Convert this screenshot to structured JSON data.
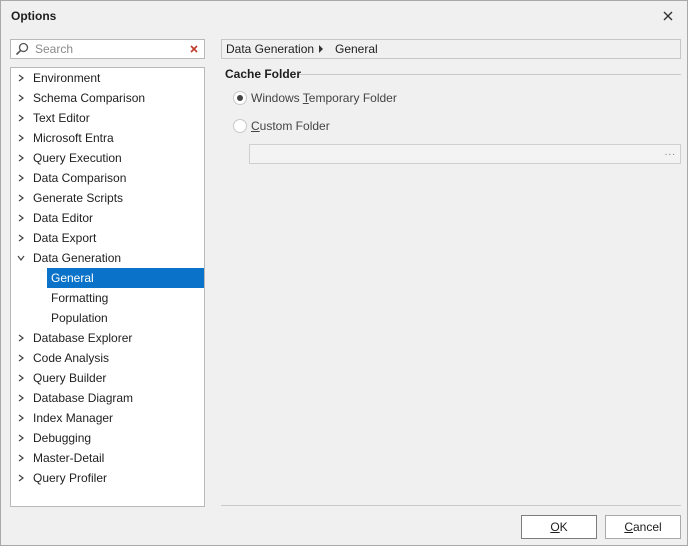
{
  "window": {
    "title": "Options"
  },
  "search": {
    "placeholder": "Search"
  },
  "tree": {
    "items": [
      {
        "label": "Environment"
      },
      {
        "label": "Schema Comparison"
      },
      {
        "label": "Text Editor"
      },
      {
        "label": "Microsoft Entra"
      },
      {
        "label": "Query Execution"
      },
      {
        "label": "Data Comparison"
      },
      {
        "label": "Generate Scripts"
      },
      {
        "label": "Data Editor"
      },
      {
        "label": "Data Export"
      },
      {
        "label": "Data Generation"
      },
      {
        "label": "General"
      },
      {
        "label": "Formatting"
      },
      {
        "label": "Population"
      },
      {
        "label": "Database Explorer"
      },
      {
        "label": "Code Analysis"
      },
      {
        "label": "Query Builder"
      },
      {
        "label": "Database Diagram"
      },
      {
        "label": "Index Manager"
      },
      {
        "label": "Debugging"
      },
      {
        "label": "Master-Detail"
      },
      {
        "label": "Query Profiler"
      }
    ]
  },
  "breadcrumb": {
    "first": "Data Generation",
    "second": "General"
  },
  "cache_folder": {
    "title": "Cache Folder",
    "option1_pre": "Windows ",
    "option1_ul": "T",
    "option1_post": "emporary Folder",
    "option2_ul": "C",
    "option2_post": "ustom Folder",
    "path_value": "",
    "ellipsis": "..."
  },
  "buttons": {
    "ok_ul": "O",
    "ok_post": "K",
    "cancel_ul": "C",
    "cancel_post": "ancel"
  },
  "colors": {
    "selection": "#0a73c9"
  }
}
